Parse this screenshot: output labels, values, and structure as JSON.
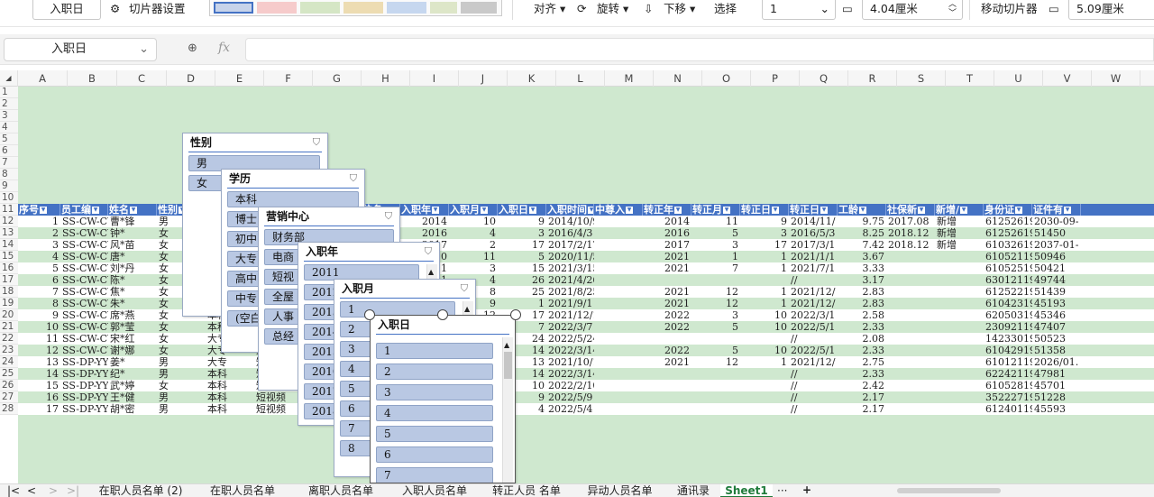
{
  "toolbar": {
    "field_value": "入职日",
    "slicer_settings": "切片器设置",
    "align": "对齐",
    "rotate": "旋转",
    "move_down": "下移",
    "select": "选择",
    "columns_value": "1",
    "height_value": "4.04厘米",
    "move_slicer": "移动切片器",
    "width_value": "5.09厘米"
  },
  "formula_bar": {
    "name_box": "入职日",
    "fx": "fx"
  },
  "columns": [
    "A",
    "B",
    "C",
    "D",
    "E",
    "F",
    "G",
    "H",
    "I",
    "J",
    "K",
    "L",
    "M",
    "N",
    "O",
    "P",
    "Q",
    "R",
    "S",
    "T",
    "U",
    "V",
    "W"
  ],
  "row_numbers": [
    "1",
    "2",
    "3",
    "4",
    "5",
    "6",
    "7",
    "8",
    "9",
    "10",
    "11",
    "12",
    "13",
    "14",
    "15",
    "16",
    "17",
    "18",
    "19",
    "20",
    "21",
    "22",
    "23",
    "24",
    "25",
    "26",
    "27",
    "28"
  ],
  "header_row": [
    "序号",
    "员工编",
    "姓名",
    "性别",
    "学历",
    "部门",
    "职位名",
    "职位名",
    "入职年",
    "入职月",
    "入职日",
    "入职时间",
    "中尊入",
    "转正年",
    "转正月",
    "转正日",
    "转正日",
    "工龄",
    "社保新",
    "新增/",
    "身份证",
    "证件有"
  ],
  "rows": [
    [
      "1",
      "SS-CW-CW",
      "曹*锋",
      "男",
      "",
      "",
      "",
      "经理",
      "2014",
      "10",
      "9",
      "2014/10/9",
      "",
      "2014",
      "11",
      "9",
      "2014/11/",
      "9.75",
      "2017.08",
      "新增",
      "61252619",
      "2030-09-"
    ],
    [
      "2",
      "SS-CW-CW",
      "钟*",
      "女",
      "",
      "",
      "",
      "主管",
      "2016",
      "4",
      "3",
      "2016/4/3",
      "",
      "2016",
      "5",
      "3",
      "2016/5/3",
      "8.25",
      "2018.12",
      "新增",
      "61252619",
      "51450"
    ],
    [
      "3",
      "SS-CW-CW",
      "风*苗",
      "女",
      "",
      "",
      "",
      "会计",
      "2017",
      "2",
      "17",
      "2017/2/17",
      "",
      "2017",
      "3",
      "17",
      "2017/3/1",
      "7.42",
      "2018.12",
      "新增",
      "61032619",
      "2037-01-"
    ],
    [
      "4",
      "SS-CW-CW",
      "唐*",
      "女",
      "",
      "",
      "",
      "",
      "2020",
      "11",
      "5",
      "2020/11/5",
      "",
      "2021",
      "1",
      "1",
      "2021/1/1",
      "3.67",
      "",
      "",
      "61052119",
      "50946"
    ],
    [
      "5",
      "SS-CW-CW",
      "刘*丹",
      "女",
      "",
      "",
      "",
      "",
      "2021",
      "3",
      "15",
      "2021/3/15",
      "",
      "2021",
      "7",
      "1",
      "2021/7/1",
      "3.33",
      "",
      "",
      "61052519",
      "50421"
    ],
    [
      "6",
      "SS-CW-CW",
      "陈*",
      "女",
      "",
      "",
      "",
      "",
      "2021",
      "4",
      "26",
      "2021/4/26",
      "",
      "",
      "",
      "",
      "//",
      "3.17",
      "",
      "",
      "63012119",
      "49744"
    ],
    [
      "7",
      "SS-CW-CW",
      "焦*",
      "女",
      "",
      "",
      "",
      "",
      "2021",
      "8",
      "25",
      "2021/8/25",
      "",
      "2021",
      "12",
      "1",
      "2021/12/",
      "2.83",
      "",
      "",
      "61252219",
      "51439"
    ],
    [
      "8",
      "SS-CW-CW",
      "朱*",
      "女",
      "",
      "",
      "",
      "",
      "2021",
      "9",
      "1",
      "2021/9/1",
      "",
      "2021",
      "12",
      "1",
      "2021/12/",
      "2.83",
      "",
      "",
      "61042319",
      "45193"
    ],
    [
      "9",
      "SS-CW-CW",
      "席*燕",
      "女",
      "本科",
      "",
      "",
      "",
      "2021",
      "12",
      "17",
      "2021/12/17",
      "",
      "2022",
      "3",
      "10",
      "2022/3/1",
      "2.58",
      "",
      "",
      "62050319",
      "45346"
    ],
    [
      "10",
      "SS-CW-CW",
      "郭*莹",
      "女",
      "本科",
      "",
      "",
      "",
      "2022",
      "3",
      "7",
      "2022/3/7",
      "",
      "2022",
      "5",
      "10",
      "2022/5/1",
      "2.33",
      "",
      "",
      "23092119",
      "47407"
    ],
    [
      "11",
      "SS-CW-CW",
      "宋*红",
      "女",
      "大专",
      "",
      "",
      "",
      "2022",
      "5",
      "24",
      "2022/5/24",
      "",
      "",
      "",
      "",
      "//",
      "2.08",
      "",
      "",
      "14233019",
      "50523"
    ],
    [
      "12",
      "SS-CW-CW",
      "谢*娜",
      "女",
      "大专",
      "财务部",
      "",
      "",
      "2022",
      "3",
      "14",
      "2022/3/14",
      "",
      "2022",
      "5",
      "10",
      "2022/5/1",
      "2.33",
      "",
      "",
      "61042919",
      "51358"
    ],
    [
      "13",
      "SS-DP-YY",
      "姜*",
      "男",
      "大专",
      "短视频",
      "",
      "",
      "2021",
      "10",
      "13",
      "2021/10/13",
      "",
      "2021",
      "12",
      "1",
      "2021/12/",
      "2.75",
      "",
      "",
      "61012119",
      "2026/01."
    ],
    [
      "14",
      "SS-DP-YY",
      "纪*",
      "男",
      "本科",
      "短视频",
      "",
      "",
      "2022",
      "3",
      "14",
      "2022/3/14",
      "",
      "",
      "",
      "",
      "//",
      "2.33",
      "",
      "",
      "62242119",
      "47981"
    ],
    [
      "15",
      "SS-DP-YY",
      "武*婷",
      "女",
      "本科",
      "短视频",
      "店铺",
      "",
      "2022",
      "2",
      "10",
      "2022/2/10",
      "",
      "",
      "",
      "",
      "//",
      "2.42",
      "",
      "",
      "61052819",
      "45701"
    ],
    [
      "16",
      "SS-DP-YY",
      "王*健",
      "男",
      "本科",
      "短视频",
      "直播",
      "",
      "2022",
      "5",
      "9",
      "2022/5/9",
      "",
      "",
      "",
      "",
      "//",
      "2.17",
      "",
      "",
      "35222719",
      "51228"
    ],
    [
      "17",
      "SS-DP-YY",
      "胡*密",
      "男",
      "本科",
      "短视频",
      "店铺运营",
      "",
      "2022",
      "5",
      "4",
      "2022/5/4",
      "",
      "",
      "",
      "",
      "//",
      "2.17",
      "",
      "",
      "61240119",
      "45593"
    ]
  ],
  "slicers": {
    "gender": {
      "title": "性别",
      "items": [
        "男",
        "女"
      ]
    },
    "education": {
      "title": "学历",
      "items": [
        "本科",
        "博士",
        "初中",
        "大专",
        "高中",
        "中专",
        "(空白)"
      ]
    },
    "department": {
      "title": "营销中心",
      "items": [
        "财务部",
        "电商",
        "短视",
        "全屋",
        "人事",
        "总经"
      ]
    },
    "year": {
      "title": "入职年",
      "items": [
        "2011",
        "2012",
        "2013",
        "2014",
        "2015",
        "2016",
        "2017",
        "2018"
      ]
    },
    "month": {
      "title": "入职月",
      "items": [
        "1",
        "2",
        "3",
        "4",
        "5",
        "6",
        "7",
        "8"
      ]
    },
    "day": {
      "title": "入职日",
      "items": [
        "1",
        "2",
        "3",
        "4",
        "5",
        "6",
        "7"
      ]
    }
  },
  "sheet_tabs": [
    "在职人员名单 (2)",
    "在职人员名单",
    "离职人员名单",
    "入职人员名单",
    "转正人员 名单",
    "异动人员名单",
    "通讯录",
    "Sheet1"
  ],
  "active_tab": "Sheet1",
  "colors": {
    "header_fill": "#4472c4",
    "band_green": "#cfe8cf",
    "band_white": "#ffffff",
    "slicer_item": "#b9c8e3"
  }
}
